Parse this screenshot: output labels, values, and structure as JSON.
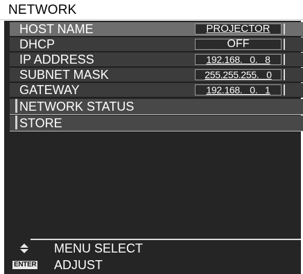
{
  "title": "NETWORK",
  "rows": [
    {
      "label": "HOST NAME",
      "value": "PROJECTOR"
    },
    {
      "label": "DHCP",
      "value": "OFF"
    },
    {
      "label": "IP ADDRESS",
      "value": "192.168.   0.   8"
    },
    {
      "label": "SUBNET MASK",
      "value": "255.255.255.   0"
    },
    {
      "label": "GATEWAY",
      "value": "192.168.   0.   1"
    }
  ],
  "actions": [
    {
      "label": "NETWORK STATUS"
    },
    {
      "label": "STORE"
    }
  ],
  "footer": {
    "menu_select_label": "MENU SELECT",
    "adjust_label": "ADJUST",
    "enter_key_label": "ENTER"
  },
  "colors": {
    "panel_bg": "#252525",
    "row_bg": "#3c3c3c",
    "selected_row_bg": "#6e6e6e",
    "text": "#ffffff"
  }
}
